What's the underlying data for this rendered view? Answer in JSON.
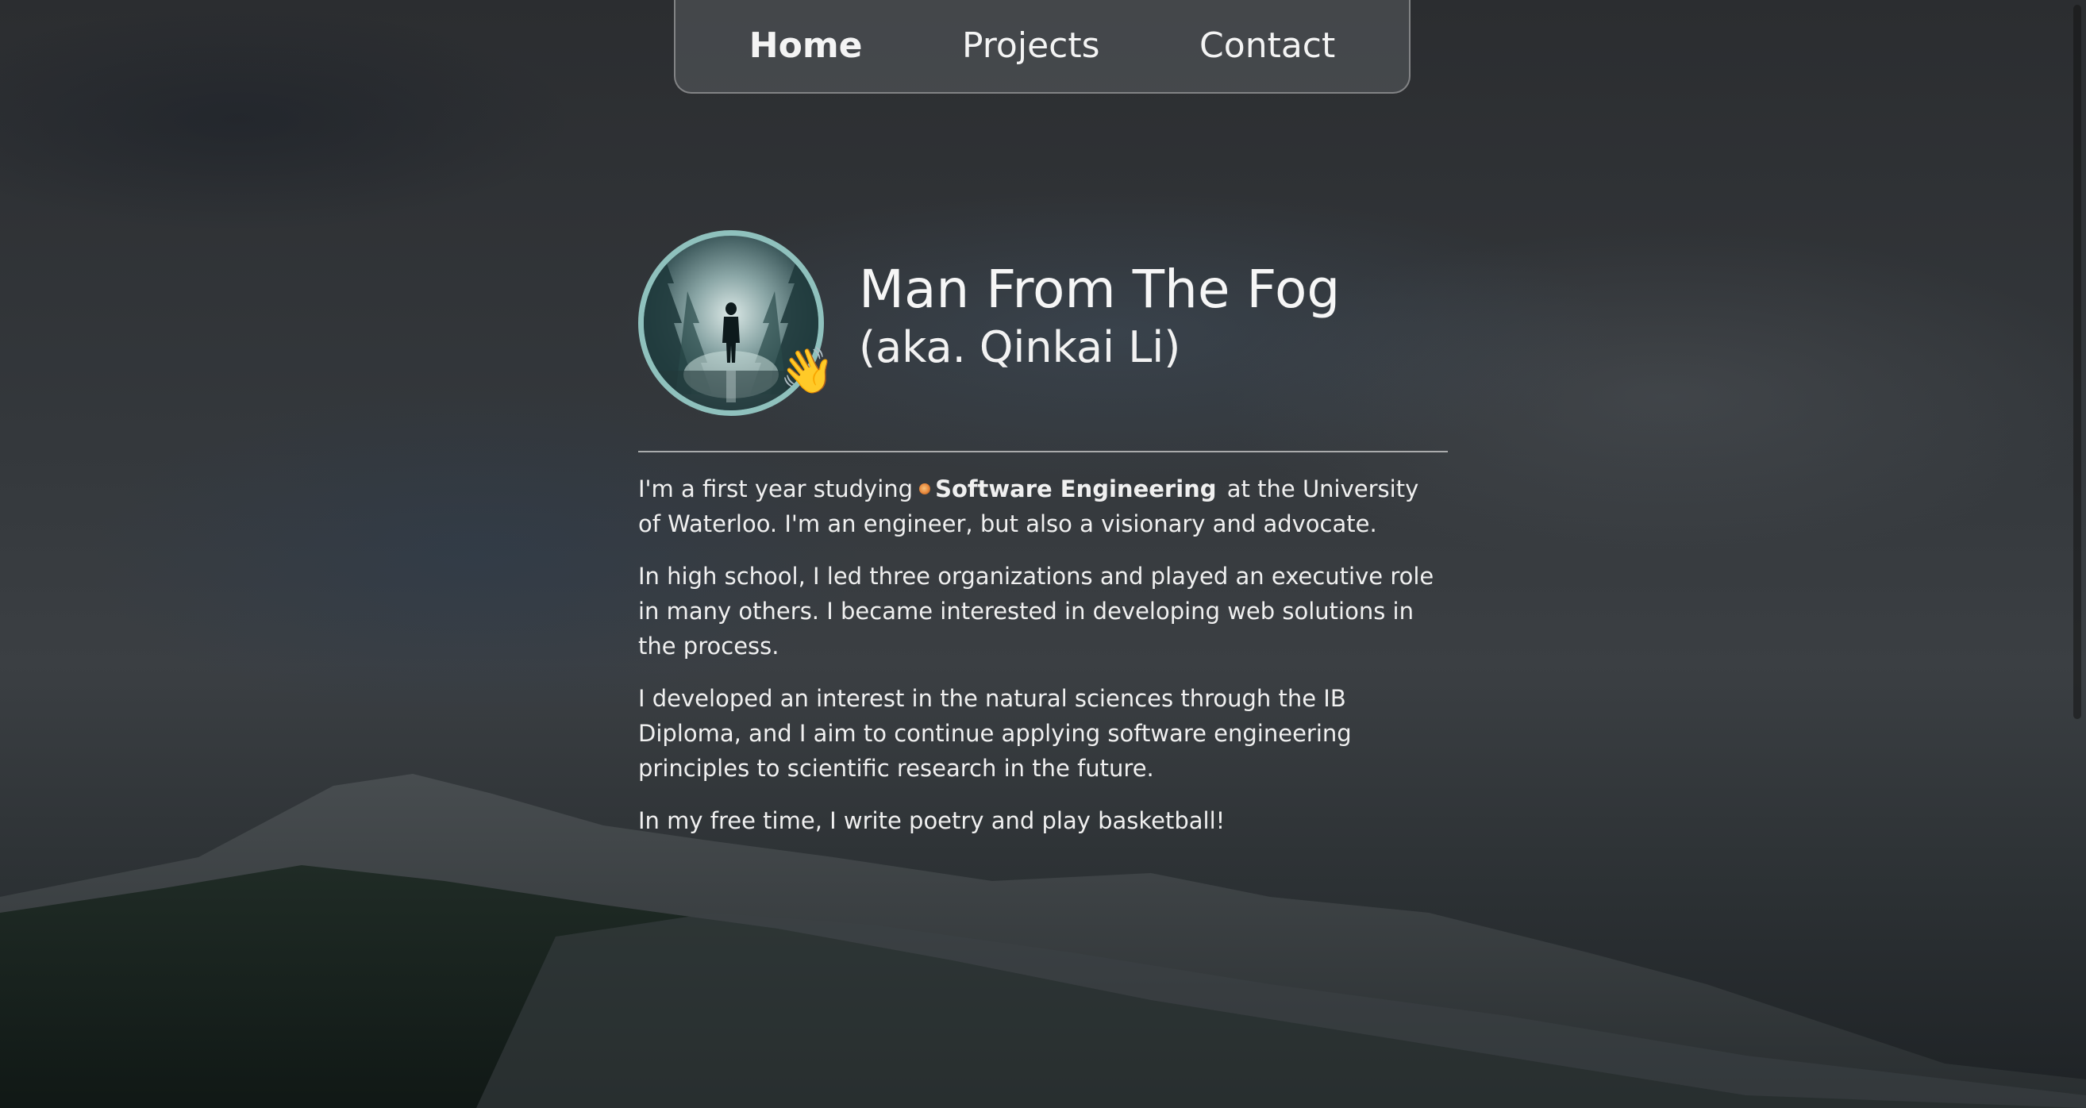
{
  "nav": {
    "items": [
      {
        "label": "Home",
        "active": true
      },
      {
        "label": "Projects",
        "active": false
      },
      {
        "label": "Contact",
        "active": false
      }
    ]
  },
  "profile": {
    "name": "Man From The Fog",
    "aka": "(aka. Qinkai Li)",
    "wave_emoji": "👋"
  },
  "bio": {
    "p1_before": "I'm a first year studying",
    "p1_major": "Software Engineering",
    "p1_after": "at the University of Waterloo. I'm an engineer, but also a visionary and advocate.",
    "p2": "In high school, I led three organizations and played an executive role in many others. I became interested in developing web solutions in the process.",
    "p3": "I developed an interest in the natural sciences through the IB Diploma, and I aim to continue applying software engineering principles to scientific research in the future.",
    "p4": "In my free time, I write poetry and play basketball!"
  },
  "icons": {
    "major_dot": "orange-dot-icon",
    "wave": "waving-hand-icon"
  },
  "colors": {
    "avatar_border": "#8fc1bd",
    "text": "#f2f2f2",
    "nav_bg": "rgba(90,92,96,0.55)"
  }
}
